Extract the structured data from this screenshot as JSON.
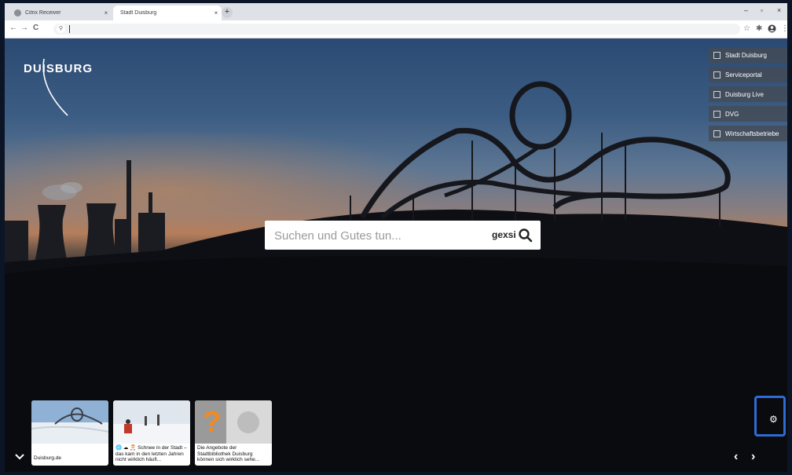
{
  "browser": {
    "tabs": [
      {
        "title": "Citrix Receiver",
        "active": false
      },
      {
        "title": "Stadt Duisburg",
        "active": true
      }
    ],
    "new_tab_symbol": "+",
    "window_controls": {
      "minimize": "–",
      "maximize": "▫",
      "close": "×"
    },
    "nav": {
      "back": "←",
      "forward": "→",
      "reload": "C"
    },
    "address_value": "",
    "toolbar_icons": [
      "star-icon",
      "extensions-icon",
      "profile-icon",
      "menu-icon"
    ]
  },
  "site": {
    "logo_text": "DUISBURG",
    "external_links": [
      {
        "label": "Stadt Duisburg"
      },
      {
        "label": "Serviceportal"
      },
      {
        "label": "Duisburg Live"
      },
      {
        "label": "DVG"
      },
      {
        "label": "Wirtschaftsbetriebe"
      }
    ],
    "search": {
      "placeholder": "Suchen und Gutes tun...",
      "value": "",
      "brand": "gexsi"
    },
    "cards": [
      {
        "caption": "Duisburg.de"
      },
      {
        "caption": "🌐 ☁ 🎅 Schnee in der Stadt – das kam in den letzten Jahren nicht wirklich häufi..."
      },
      {
        "caption": "Die Angebote der Stadtbibliothek Duisburg können sich wirklich sehe..."
      }
    ],
    "controls": {
      "prev": "‹",
      "next": "›",
      "settings_icon": "gear-icon",
      "collapse_icon": "chevron-down-icon"
    }
  },
  "colors": {
    "accent_highlight": "#2f6bd6",
    "chrome_bg": "#dee1e6"
  }
}
